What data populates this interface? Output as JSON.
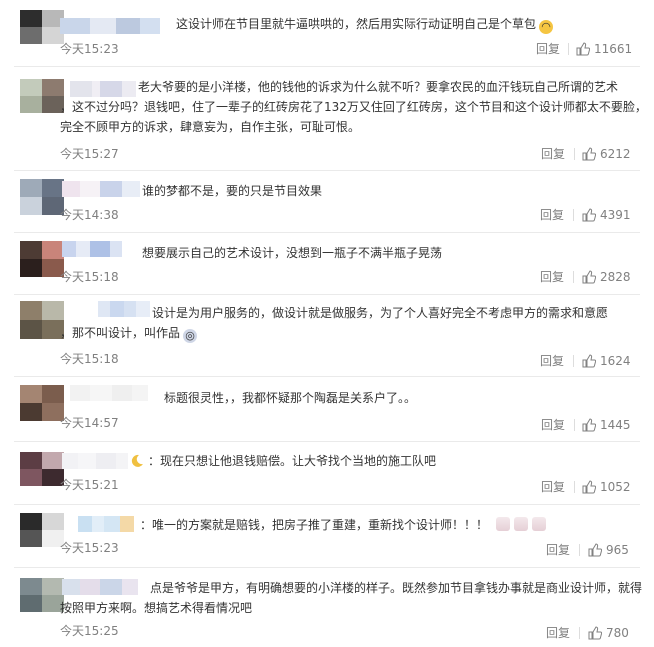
{
  "comments": [
    {
      "text_lines": [
        "这设计师在节目里就牛逼哄哄的，然后用实际行动证明自己是个草包"
      ],
      "emoji": "😮",
      "time": "今天15:23",
      "reply": "回复",
      "likes": "11661",
      "avatar": [
        "#2d2d2d",
        "#b8b8b8",
        "#6d6d6d",
        "#d5d5d5"
      ],
      "name_colors": [
        "#c9d6ea",
        "#e4e9f3",
        "#bcc9df",
        "#d3dff0"
      ]
    },
    {
      "text_lines": [
        "老大爷要的是小洋楼，他的钱他的诉求为什么就不听？要拿农民的血汗钱玩自己所谓的艺术",
        "，这不过分吗？退钱吧，住了一辈子的红砖房花了132万又住回了红砖房，这个节目和这个设计师都太不要脸，",
        "完全不顾甲方的诉求，肆意妄为，自作主张，可耻可恨。"
      ],
      "emoji": "",
      "time": "今天15:27",
      "reply": "回复",
      "likes": "6212",
      "avatar": [
        "#c3cbbb",
        "#8d7b6f",
        "#a8b09e",
        "#6b625a"
      ],
      "name_colors": [
        "#e3e4ec",
        "#f0eef4",
        "#d6d8e8",
        "#ecebf2"
      ]
    },
    {
      "text_lines": [
        "谁的梦都不是，要的只是节目效果"
      ],
      "emoji": "",
      "time": "今天14:38",
      "reply": "回复",
      "likes": "4391",
      "avatar": [
        "#9eaab8",
        "#687486",
        "#cad2dc",
        "#5e6776"
      ],
      "name_colors": [
        "#efe4ee",
        "#f6f2f6",
        "#c9d3ea",
        "#e8edf6"
      ]
    },
    {
      "text_lines": [
        "想要展示自己的艺术设计，没想到一瓶子不满半瓶子晃荡"
      ],
      "emoji": "",
      "time": "今天15:18",
      "reply": "回复",
      "likes": "2828",
      "avatar": [
        "#4d3b34",
        "#c9847a",
        "#2b1f1d",
        "#8a5a4c"
      ],
      "name_colors": [
        "#c8d4ee",
        "#e6ebf6",
        "#aec1e6",
        "#dbe3f3"
      ]
    },
    {
      "text_lines": [
        "设计是为用户服务的，做设计就是做服务，为了个人喜好完全不考虑甲方的需求和意愿",
        "，那不叫设计，叫作品"
      ],
      "emoji": "😱",
      "time": "今天15:18",
      "reply": "回复",
      "likes": "1624",
      "avatar": [
        "#8e7f6a",
        "#b9b8a9",
        "#5c5446",
        "#7a6f5b"
      ],
      "name_colors": [
        "#dfe7f4",
        "#cad8ef",
        "#d6e1f2",
        "#e7edf7"
      ]
    },
    {
      "text_lines": [
        "标题很灵性，，我都怀疑那个陶磊是关系户了。。"
      ],
      "emoji": "",
      "time": "今天14:57",
      "reply": "回复",
      "likes": "1445",
      "avatar": [
        "#a48572",
        "#7b5d4d",
        "#4b3a31",
        "#8e6f5e"
      ],
      "name_colors": [
        "#f2f2f2",
        "#f6f6f6",
        "#efefef",
        "#f4f4f4"
      ]
    },
    {
      "text_lines": [
        "现在只想让他退钱赔偿。让大爷找个当地的施工队吧"
      ],
      "emoji": "",
      "time": "今天15:21",
      "reply": "回复",
      "likes": "1052",
      "avatar": [
        "#5c3d44",
        "#c2a8ad",
        "#7e5660",
        "#3d2a2f"
      ],
      "name_colors": [
        "#f2f2f5",
        "#f6f6f8",
        "#eeeef2",
        "#f4f4f6"
      ]
    },
    {
      "text_lines": [
        "唯一的方案就是赔钱，把房子推了重建，重新找个设计师！！！"
      ],
      "emoji": "",
      "time": "今天15:23",
      "reply": "回复",
      "likes": "965",
      "avatar": [
        "#2a2a2a",
        "#d7d7d7",
        "#555555",
        "#f0f0f0"
      ],
      "name_colors": [
        "#c9e0f2",
        "#e2eef8",
        "#d4e6f4",
        "#f4d9a7"
      ]
    },
    {
      "text_lines": [
        "点是爷爷是甲方，有明确想要的小洋楼的样子。既然参加节目拿钱办事就是商业设计师，就得",
        "按照甲方来啊。想搞艺术得看情况吧"
      ],
      "emoji": "",
      "time": "今天15:25",
      "reply": "回复",
      "likes": "780",
      "avatar": [
        "#7d8a8f",
        "#b3b9b0",
        "#5f6c70",
        "#9aa49a"
      ],
      "name_colors": [
        "#d8e0ec",
        "#e4ddea",
        "#cbd6e8",
        "#e9e4ef"
      ]
    }
  ],
  "icons": {
    "thumb": "thumbs-up-icon",
    "moon": "moon-icon",
    "rabbit": "rabbit-emoji-icon"
  },
  "colors": {
    "meta": "#808080",
    "text": "#333333",
    "divider": "#eaeaea"
  }
}
